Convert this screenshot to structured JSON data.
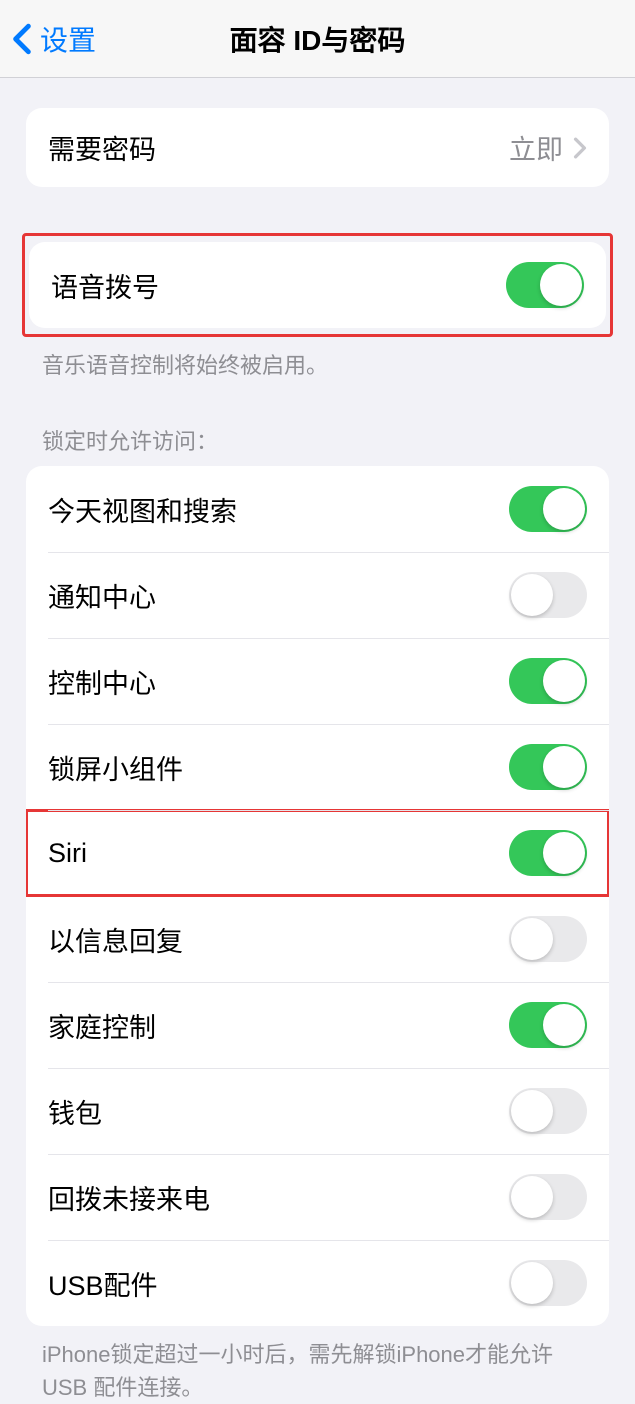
{
  "header": {
    "back_label": "设置",
    "title": "面容 ID与密码"
  },
  "require_passcode": {
    "label": "需要密码",
    "value": "立即"
  },
  "voice_dial": {
    "label": "语音拨号",
    "on": true,
    "footer": "音乐语音控制将始终被启用。"
  },
  "lock_access": {
    "header": "锁定时允许访问：",
    "items": [
      {
        "label": "今天视图和搜索",
        "on": true
      },
      {
        "label": "通知中心",
        "on": false
      },
      {
        "label": "控制中心",
        "on": true
      },
      {
        "label": "锁屏小组件",
        "on": true
      },
      {
        "label": "Siri",
        "on": true,
        "highlight": true
      },
      {
        "label": "以信息回复",
        "on": false
      },
      {
        "label": "家庭控制",
        "on": true
      },
      {
        "label": "钱包",
        "on": false
      },
      {
        "label": "回拨未接来电",
        "on": false
      },
      {
        "label": "USB配件",
        "on": false
      }
    ],
    "footer": "iPhone锁定超过一小时后，需先解锁iPhone才能允许\nUSB 配件连接。"
  }
}
